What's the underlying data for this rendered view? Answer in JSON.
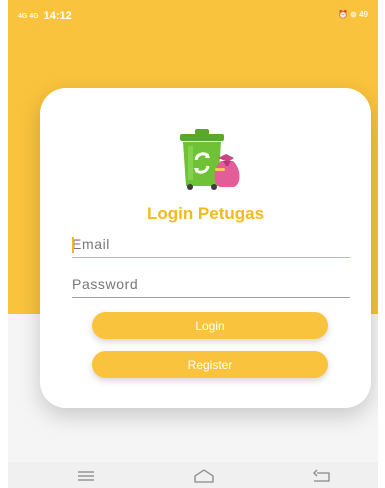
{
  "status_bar": {
    "signal": "4G 4G",
    "time": "14:12",
    "right_indicators": "⏰ ⊜ 49"
  },
  "login": {
    "title": "Login Petugas",
    "email_placeholder": "Email",
    "password_placeholder": "Password",
    "login_label": "Login",
    "register_label": "Register"
  },
  "icons": {
    "logo": "recycle-bin-icon",
    "nav": [
      "menu-icon",
      "home-icon",
      "back-icon"
    ]
  },
  "colors": {
    "accent": "#f9c33d",
    "title": "#f6b91c",
    "bin": "#6fc236",
    "bag": "#e45c98"
  }
}
